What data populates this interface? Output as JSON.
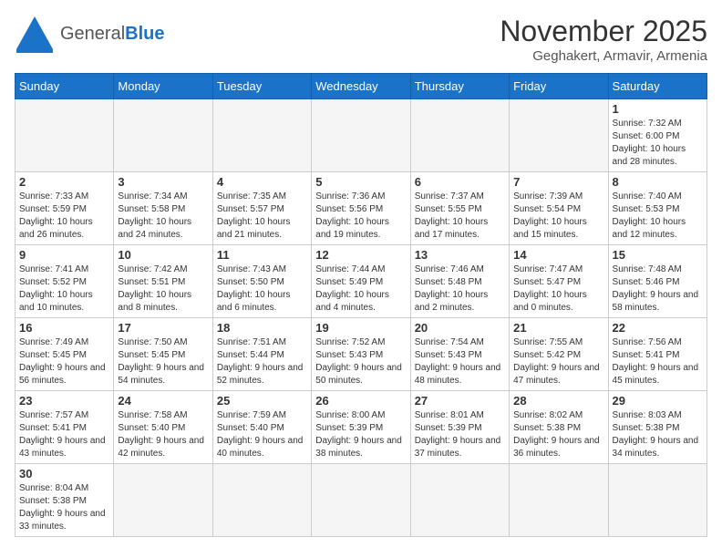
{
  "header": {
    "logo_general": "General",
    "logo_blue": "Blue",
    "title": "November 2025",
    "subtitle": "Geghakert, Armavir, Armenia"
  },
  "weekdays": [
    "Sunday",
    "Monday",
    "Tuesday",
    "Wednesday",
    "Thursday",
    "Friday",
    "Saturday"
  ],
  "weeks": [
    [
      {
        "day": null,
        "info": ""
      },
      {
        "day": null,
        "info": ""
      },
      {
        "day": null,
        "info": ""
      },
      {
        "day": null,
        "info": ""
      },
      {
        "day": null,
        "info": ""
      },
      {
        "day": null,
        "info": ""
      },
      {
        "day": "1",
        "info": "Sunrise: 7:32 AM\nSunset: 6:00 PM\nDaylight: 10 hours and 28 minutes."
      }
    ],
    [
      {
        "day": "2",
        "info": "Sunrise: 7:33 AM\nSunset: 5:59 PM\nDaylight: 10 hours and 26 minutes."
      },
      {
        "day": "3",
        "info": "Sunrise: 7:34 AM\nSunset: 5:58 PM\nDaylight: 10 hours and 24 minutes."
      },
      {
        "day": "4",
        "info": "Sunrise: 7:35 AM\nSunset: 5:57 PM\nDaylight: 10 hours and 21 minutes."
      },
      {
        "day": "5",
        "info": "Sunrise: 7:36 AM\nSunset: 5:56 PM\nDaylight: 10 hours and 19 minutes."
      },
      {
        "day": "6",
        "info": "Sunrise: 7:37 AM\nSunset: 5:55 PM\nDaylight: 10 hours and 17 minutes."
      },
      {
        "day": "7",
        "info": "Sunrise: 7:39 AM\nSunset: 5:54 PM\nDaylight: 10 hours and 15 minutes."
      },
      {
        "day": "8",
        "info": "Sunrise: 7:40 AM\nSunset: 5:53 PM\nDaylight: 10 hours and 12 minutes."
      }
    ],
    [
      {
        "day": "9",
        "info": "Sunrise: 7:41 AM\nSunset: 5:52 PM\nDaylight: 10 hours and 10 minutes."
      },
      {
        "day": "10",
        "info": "Sunrise: 7:42 AM\nSunset: 5:51 PM\nDaylight: 10 hours and 8 minutes."
      },
      {
        "day": "11",
        "info": "Sunrise: 7:43 AM\nSunset: 5:50 PM\nDaylight: 10 hours and 6 minutes."
      },
      {
        "day": "12",
        "info": "Sunrise: 7:44 AM\nSunset: 5:49 PM\nDaylight: 10 hours and 4 minutes."
      },
      {
        "day": "13",
        "info": "Sunrise: 7:46 AM\nSunset: 5:48 PM\nDaylight: 10 hours and 2 minutes."
      },
      {
        "day": "14",
        "info": "Sunrise: 7:47 AM\nSunset: 5:47 PM\nDaylight: 10 hours and 0 minutes."
      },
      {
        "day": "15",
        "info": "Sunrise: 7:48 AM\nSunset: 5:46 PM\nDaylight: 9 hours and 58 minutes."
      }
    ],
    [
      {
        "day": "16",
        "info": "Sunrise: 7:49 AM\nSunset: 5:45 PM\nDaylight: 9 hours and 56 minutes."
      },
      {
        "day": "17",
        "info": "Sunrise: 7:50 AM\nSunset: 5:45 PM\nDaylight: 9 hours and 54 minutes."
      },
      {
        "day": "18",
        "info": "Sunrise: 7:51 AM\nSunset: 5:44 PM\nDaylight: 9 hours and 52 minutes."
      },
      {
        "day": "19",
        "info": "Sunrise: 7:52 AM\nSunset: 5:43 PM\nDaylight: 9 hours and 50 minutes."
      },
      {
        "day": "20",
        "info": "Sunrise: 7:54 AM\nSunset: 5:43 PM\nDaylight: 9 hours and 48 minutes."
      },
      {
        "day": "21",
        "info": "Sunrise: 7:55 AM\nSunset: 5:42 PM\nDaylight: 9 hours and 47 minutes."
      },
      {
        "day": "22",
        "info": "Sunrise: 7:56 AM\nSunset: 5:41 PM\nDaylight: 9 hours and 45 minutes."
      }
    ],
    [
      {
        "day": "23",
        "info": "Sunrise: 7:57 AM\nSunset: 5:41 PM\nDaylight: 9 hours and 43 minutes."
      },
      {
        "day": "24",
        "info": "Sunrise: 7:58 AM\nSunset: 5:40 PM\nDaylight: 9 hours and 42 minutes."
      },
      {
        "day": "25",
        "info": "Sunrise: 7:59 AM\nSunset: 5:40 PM\nDaylight: 9 hours and 40 minutes."
      },
      {
        "day": "26",
        "info": "Sunrise: 8:00 AM\nSunset: 5:39 PM\nDaylight: 9 hours and 38 minutes."
      },
      {
        "day": "27",
        "info": "Sunrise: 8:01 AM\nSunset: 5:39 PM\nDaylight: 9 hours and 37 minutes."
      },
      {
        "day": "28",
        "info": "Sunrise: 8:02 AM\nSunset: 5:38 PM\nDaylight: 9 hours and 36 minutes."
      },
      {
        "day": "29",
        "info": "Sunrise: 8:03 AM\nSunset: 5:38 PM\nDaylight: 9 hours and 34 minutes."
      }
    ],
    [
      {
        "day": "30",
        "info": "Sunrise: 8:04 AM\nSunset: 5:38 PM\nDaylight: 9 hours and 33 minutes."
      },
      {
        "day": null,
        "info": ""
      },
      {
        "day": null,
        "info": ""
      },
      {
        "day": null,
        "info": ""
      },
      {
        "day": null,
        "info": ""
      },
      {
        "day": null,
        "info": ""
      },
      {
        "day": null,
        "info": ""
      }
    ]
  ]
}
